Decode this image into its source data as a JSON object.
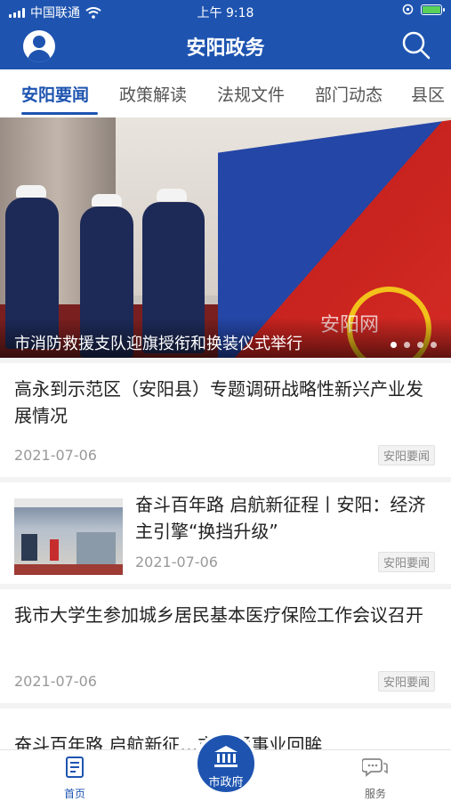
{
  "status_bar": {
    "carrier": "中国联通",
    "time": "上午 9:18"
  },
  "header": {
    "title": "安阳政务",
    "avatar_icon": "user-avatar-icon",
    "search_icon": "search-icon"
  },
  "tabs": [
    {
      "label": "安阳要闻",
      "active": true
    },
    {
      "label": "政策解读",
      "active": false
    },
    {
      "label": "法规文件",
      "active": false
    },
    {
      "label": "部门动态",
      "active": false
    },
    {
      "label": "县区",
      "active": false
    }
  ],
  "banner": {
    "caption": "市消防救援支队迎旗授衔和换装仪式举行",
    "watermark": "安阳网",
    "slide_count": 4,
    "active_slide": 1
  },
  "news": [
    {
      "title": "高永到示范区（安阳县）专题调研战略性新兴产业发展情况",
      "date": "2021-07-06",
      "tag": "安阳要闻",
      "has_thumb": false
    },
    {
      "title": "奋斗百年路 启航新征程丨安阳：经济主引擎“换挡升级”",
      "date": "2021-07-06",
      "tag": "安阳要闻",
      "has_thumb": true
    },
    {
      "title": "我市大学生参加城乡居民基本医疗保险工作会议召开",
      "date": "2021-07-06",
      "tag": "安阳要闻",
      "has_thumb": false
    },
    {
      "title": "奋斗百年路 启航新征…市交通事业回眸",
      "date": "",
      "tag": "",
      "has_thumb": false
    }
  ],
  "bottom_nav": {
    "home": "首页",
    "center": "市政府",
    "service": "服务"
  },
  "colors": {
    "primary": "#1e54b0",
    "background": "#f3f3f3"
  }
}
